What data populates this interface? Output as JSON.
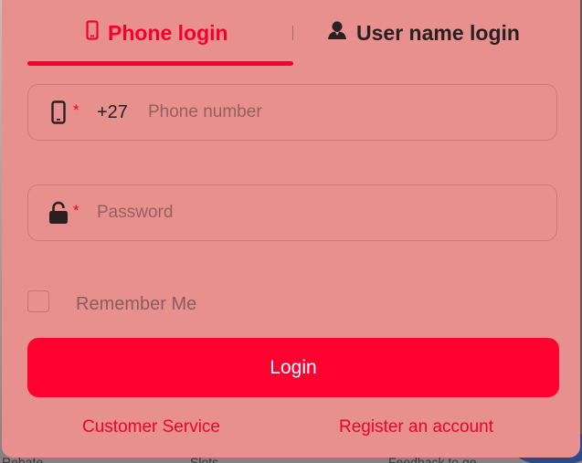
{
  "background": {
    "labels": [
      "Rebate",
      "Slots",
      "Feedback to ge"
    ]
  },
  "tabs": [
    {
      "label": "Phone login",
      "icon": "phone-icon",
      "active": true
    },
    {
      "label": "User name login",
      "icon": "user-icon",
      "active": false
    }
  ],
  "form": {
    "phone": {
      "required_mark": "*",
      "country_code": "+27",
      "placeholder": "Phone number",
      "value": ""
    },
    "password": {
      "required_mark": "*",
      "placeholder": "Password",
      "value": ""
    },
    "remember": {
      "label": "Remember Me",
      "checked": false
    },
    "submit_label": "Login"
  },
  "links": {
    "customer_service": "Customer Service",
    "register": "Register an account"
  },
  "colors": {
    "accent": "#f5002d",
    "panel": "#e8908d",
    "button": "#ff0030"
  }
}
